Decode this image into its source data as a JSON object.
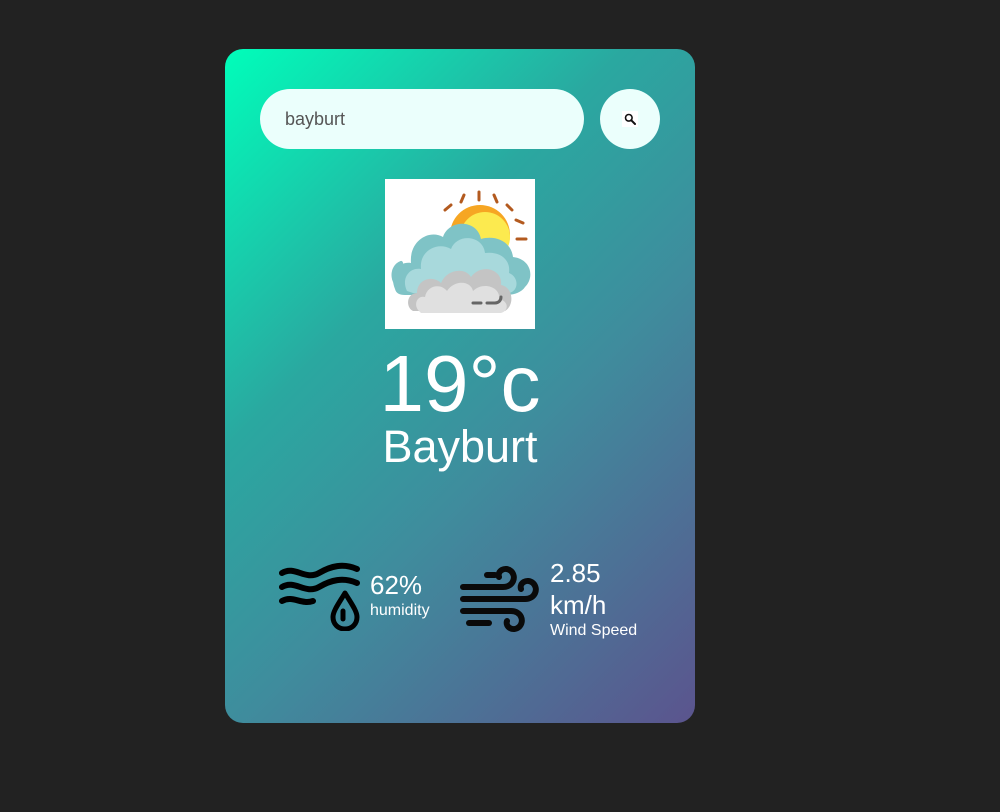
{
  "search": {
    "value": "bayburt",
    "icon": "search-icon"
  },
  "weather": {
    "icon": "partly-cloudy-sun-icon",
    "temperature": "19°c",
    "city": "Bayburt"
  },
  "details": {
    "humidity": {
      "icon": "humidity-icon",
      "value": "62%",
      "label": "humidity"
    },
    "wind": {
      "icon": "wind-icon",
      "value": "2.85 km/h",
      "label": "Wind Speed"
    }
  },
  "colors": {
    "page_background": "#222222",
    "gradient_start": "#00feba",
    "gradient_end": "#5b548e",
    "input_background": "#ebfffc",
    "text": "#ffffff"
  }
}
